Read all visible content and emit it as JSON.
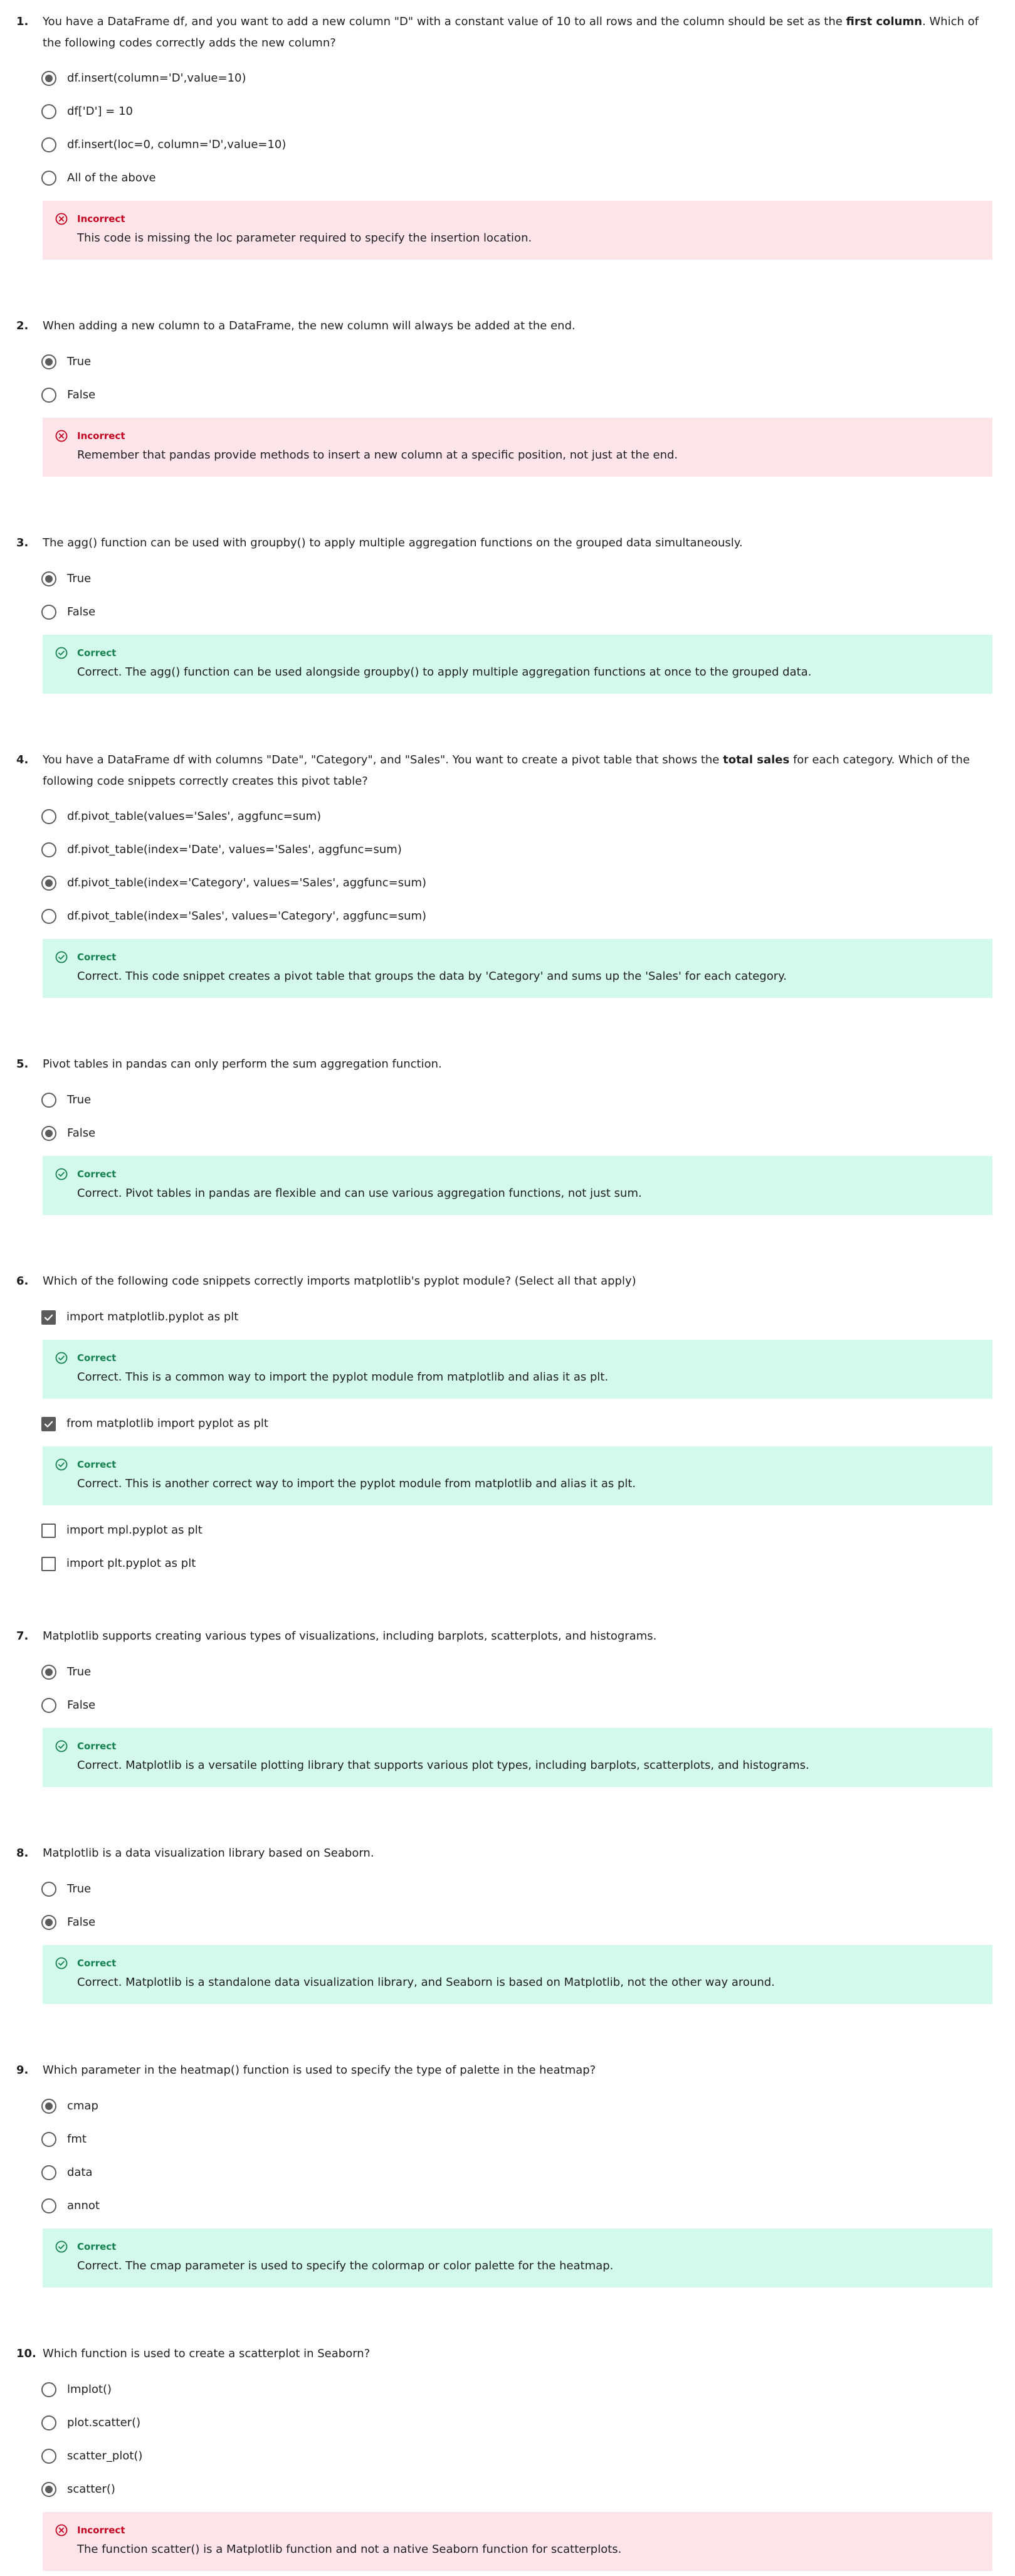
{
  "colors": {
    "incorrect_bg": "#fde4e8",
    "incorrect_text": "#c4001f",
    "correct_bg": "#d3f8ec",
    "correct_text": "#16824f",
    "control": "#5b5b5b"
  },
  "questions": [
    {
      "number": "1.",
      "text_before": "You have a DataFrame df, and you want to add a new column \"D\" with a constant value of 10 to all rows and the column should be set as the ",
      "text_bold": "first column",
      "text_after": ". Which of the following codes correctly adds the new column?",
      "options": [
        {
          "label": "df.insert(column='D',value=10)",
          "selected": true
        },
        {
          "label": "df['D'] = 10",
          "selected": false
        },
        {
          "label": "df.insert(loc=0, column='D',value=10)",
          "selected": false
        },
        {
          "label": "All of the above",
          "selected": false
        }
      ],
      "feedback": {
        "status": "Incorrect",
        "message": "This code is missing the loc parameter required to specify the insertion location.",
        "icon": "x-circle-icon"
      }
    },
    {
      "number": "2.",
      "text": "When adding a new column to a DataFrame, the new column will always be added at the end.",
      "options": [
        {
          "label": "True",
          "selected": true
        },
        {
          "label": "False",
          "selected": false
        }
      ],
      "feedback": {
        "status": "Incorrect",
        "message": "Remember that pandas provide methods to insert a new column at a specific position, not just at the end.",
        "icon": "x-circle-icon"
      }
    },
    {
      "number": "3.",
      "text": "The agg() function can be used with groupby() to apply multiple aggregation functions on the grouped data simultaneously.",
      "options": [
        {
          "label": "True",
          "selected": true
        },
        {
          "label": "False",
          "selected": false
        }
      ],
      "feedback": {
        "status": "Correct",
        "message": "Correct. The agg() function can be used alongside groupby() to apply multiple aggregation functions at once to the grouped data.",
        "icon": "check-circle-icon"
      }
    },
    {
      "number": "4.",
      "text_before": "You have a DataFrame df with columns \"Date\", \"Category\", and \"Sales\". You want to create a pivot table that shows the ",
      "text_bold": "total sales",
      "text_after": " for each category. Which of the following code snippets correctly creates this pivot table?",
      "options": [
        {
          "label": "df.pivot_table(values='Sales', aggfunc=sum)",
          "selected": false
        },
        {
          "label": "df.pivot_table(index='Date', values='Sales', aggfunc=sum)",
          "selected": false
        },
        {
          "label": "df.pivot_table(index='Category', values='Sales', aggfunc=sum)",
          "selected": true
        },
        {
          "label": "df.pivot_table(index='Sales', values='Category', aggfunc=sum)",
          "selected": false
        }
      ],
      "feedback": {
        "status": "Correct",
        "message": "Correct. This code snippet creates a pivot table that groups the data by 'Category' and sums up the 'Sales' for each category.",
        "icon": "check-circle-icon"
      }
    },
    {
      "number": "5.",
      "text": "Pivot tables in pandas can only perform the sum aggregation function.",
      "options": [
        {
          "label": "True",
          "selected": false
        },
        {
          "label": "False",
          "selected": true
        }
      ],
      "feedback": {
        "status": "Correct",
        "message": "Correct. Pivot tables in pandas are flexible and can use various aggregation functions, not just sum.",
        "icon": "check-circle-icon"
      }
    },
    {
      "number": "6.",
      "text": "Which of the following code snippets correctly imports matplotlib's pyplot module? (Select all that apply)",
      "options": [
        {
          "label": "import matplotlib.pyplot as plt",
          "selected": true,
          "feedback": {
            "status": "Correct",
            "message": "Correct. This is a common way to import the pyplot module from matplotlib and alias it as plt.",
            "icon": "check-circle-icon"
          }
        },
        {
          "label": "from matplotlib import pyplot as plt",
          "selected": true,
          "feedback": {
            "status": "Correct",
            "message": "Correct. This is another correct way to import the pyplot module from matplotlib and alias it as plt.",
            "icon": "check-circle-icon"
          }
        },
        {
          "label": "import mpl.pyplot as plt",
          "selected": false
        },
        {
          "label": "import plt.pyplot as plt",
          "selected": false
        }
      ]
    },
    {
      "number": "7.",
      "text": "Matplotlib supports creating various types of visualizations, including barplots, scatterplots, and histograms.",
      "options": [
        {
          "label": "True",
          "selected": true
        },
        {
          "label": "False",
          "selected": false
        }
      ],
      "feedback": {
        "status": "Correct",
        "message": "Correct. Matplotlib is a versatile plotting library that supports various plot types, including barplots, scatterplots, and histograms.",
        "icon": "check-circle-icon"
      }
    },
    {
      "number": "8.",
      "text": "Matplotlib is a data visualization library based on Seaborn.",
      "options": [
        {
          "label": "True",
          "selected": false
        },
        {
          "label": "False",
          "selected": true
        }
      ],
      "feedback": {
        "status": "Correct",
        "message": "Correct. Matplotlib is a standalone data visualization library, and Seaborn is based on Matplotlib, not the other way around.",
        "icon": "check-circle-icon"
      }
    },
    {
      "number": "9.",
      "text": "Which parameter in the heatmap() function is used to specify the type of palette in the heatmap?",
      "options": [
        {
          "label": "cmap",
          "selected": true
        },
        {
          "label": "fmt",
          "selected": false
        },
        {
          "label": "data",
          "selected": false
        },
        {
          "label": "annot",
          "selected": false
        }
      ],
      "feedback": {
        "status": "Correct",
        "message": "Correct. The cmap parameter is used to specify the colormap or color palette for the heatmap.",
        "icon": "check-circle-icon"
      }
    },
    {
      "number": "10.",
      "text": "Which function is used to create a scatterplot in Seaborn?",
      "options": [
        {
          "label": "lmplot()",
          "selected": false
        },
        {
          "label": "plot.scatter()",
          "selected": false
        },
        {
          "label": "scatter_plot()",
          "selected": false
        },
        {
          "label": "scatter()",
          "selected": true
        }
      ],
      "feedback": {
        "status": "Incorrect",
        "message": "The function scatter() is a Matplotlib function and not a native Seaborn function for scatterplots.",
        "icon": "x-circle-icon"
      }
    }
  ]
}
